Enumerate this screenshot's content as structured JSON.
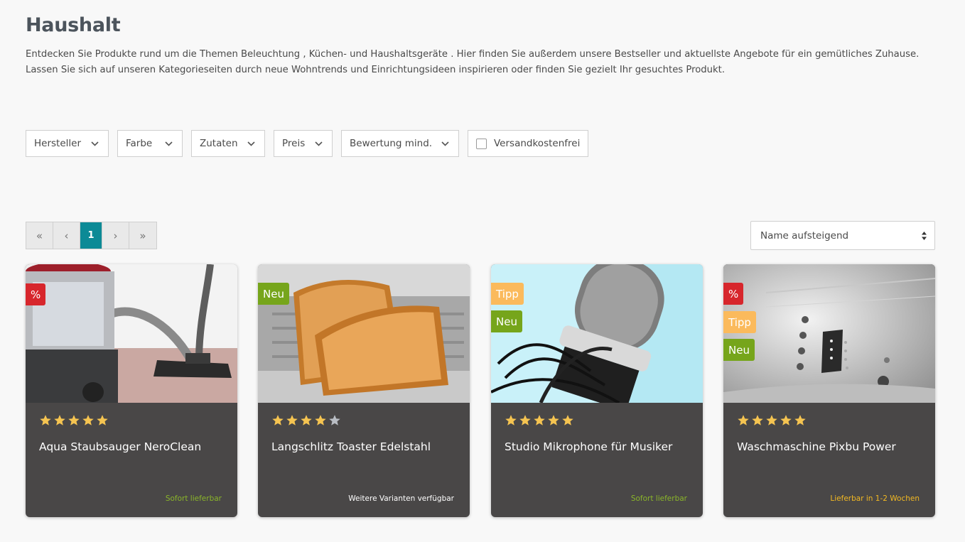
{
  "page": {
    "title": "Haushalt",
    "description_line1": "Entdecken Sie Produkte rund um die Themen Beleuchtung , Küchen- und Haushaltsgeräte . Hier finden Sie außerdem unsere Bestseller und aktuellste Angebote für ein gemütliches Zuhause.",
    "description_line2": "Lassen Sie sich auf unseren Kategorieseiten durch neue Wohntrends und Einrichtungsideen inspirieren oder finden Sie gezielt Ihr gesuchtes Produkt."
  },
  "filters": {
    "manufacturer": "Hersteller",
    "color": "Farbe",
    "ingredients": "Zutaten",
    "price": "Preis",
    "rating": "Bewertung mind.",
    "free_shipping": "Versandkostenfrei"
  },
  "pagination": {
    "first": "«",
    "prev": "‹",
    "current": "1",
    "next": "›",
    "last": "»"
  },
  "sort": {
    "selected": "Name aufsteigend"
  },
  "products": [
    {
      "name": "Aqua Staubsauger NeroClean",
      "rating": 5,
      "availability": "Sofort lieferbar",
      "badges": [
        "%"
      ]
    },
    {
      "name": "Langschlitz Toaster Edelstahl",
      "rating": 4,
      "availability": "Weitere Varianten verfügbar",
      "badges": [
        "Neu"
      ]
    },
    {
      "name": "Studio Mikrophone für Musiker",
      "rating": 5,
      "availability": "Sofort lieferbar",
      "badges": [
        "Tipp",
        "Neu"
      ]
    },
    {
      "name": "Waschmaschine Pixbu Power",
      "rating": 5,
      "availability": "Lieferbar in 1-2 Wochen",
      "badges": [
        "%",
        "Tipp",
        "Neu"
      ]
    }
  ],
  "colors": {
    "accent": "#0c8a96",
    "card_bg": "#494747",
    "star": "#f5c451",
    "star_empty": "#b9bdc4",
    "badge_sale": "#d7262c",
    "badge_new": "#76a51b",
    "badge_tip": "#fbba5c",
    "avail_instock": "#8ab52a",
    "avail_variants": "#ffffff",
    "avail_weeks": "#f3b922"
  },
  "icons": {
    "dropdown": "chevron-down-icon",
    "sort": "updown-arrows-icon",
    "rating": "star-icon"
  }
}
